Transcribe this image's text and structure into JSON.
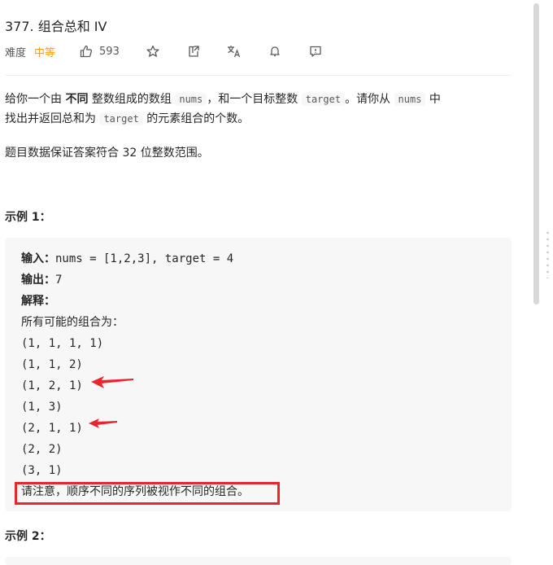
{
  "problem": {
    "title": "377. 组合总和 IV",
    "difficulty_label": "难度",
    "difficulty": "中等",
    "likes": "593",
    "icons": [
      "thumbs-up-icon",
      "star-icon",
      "share-icon",
      "translate-icon",
      "bell-icon",
      "feedback-icon"
    ]
  },
  "description": {
    "p1_a": "给你一个由",
    "p1_b": "不同",
    "p1_c": "整数组成的数组",
    "p1_code1": "nums",
    "p1_d": "，和一个目标整数",
    "p1_code2": "target",
    "p1_e": "。请你从",
    "p1_code3": "nums",
    "p1_f": "中",
    "p1_g": "找出并返回总和为",
    "p1_code4": "target",
    "p1_h": "的元素组合的个数。",
    "p2": "题目数据保证答案符合 32 位整数范围。"
  },
  "example1": {
    "title": "示例 1：",
    "input_label": "输入：",
    "input_value": "nums = [1,2,3], target = 4",
    "output_label": "输出：",
    "output_value": "7",
    "explain_label": "解释：",
    "explain_intro": "所有可能的组合为：",
    "combos": [
      "(1, 1, 1, 1)",
      "(1, 1, 2)",
      "(1, 2, 1)",
      "(1, 3)",
      "(2, 1, 1)",
      "(2, 2)",
      "(3, 1)"
    ],
    "note": "请注意，顺序不同的序列被视作不同的组合。"
  },
  "example2": {
    "title": "示例 2："
  },
  "colors": {
    "accent": "#ffa116",
    "annotation_red": "#e8262b",
    "code_bg": "#f7f7f8"
  }
}
